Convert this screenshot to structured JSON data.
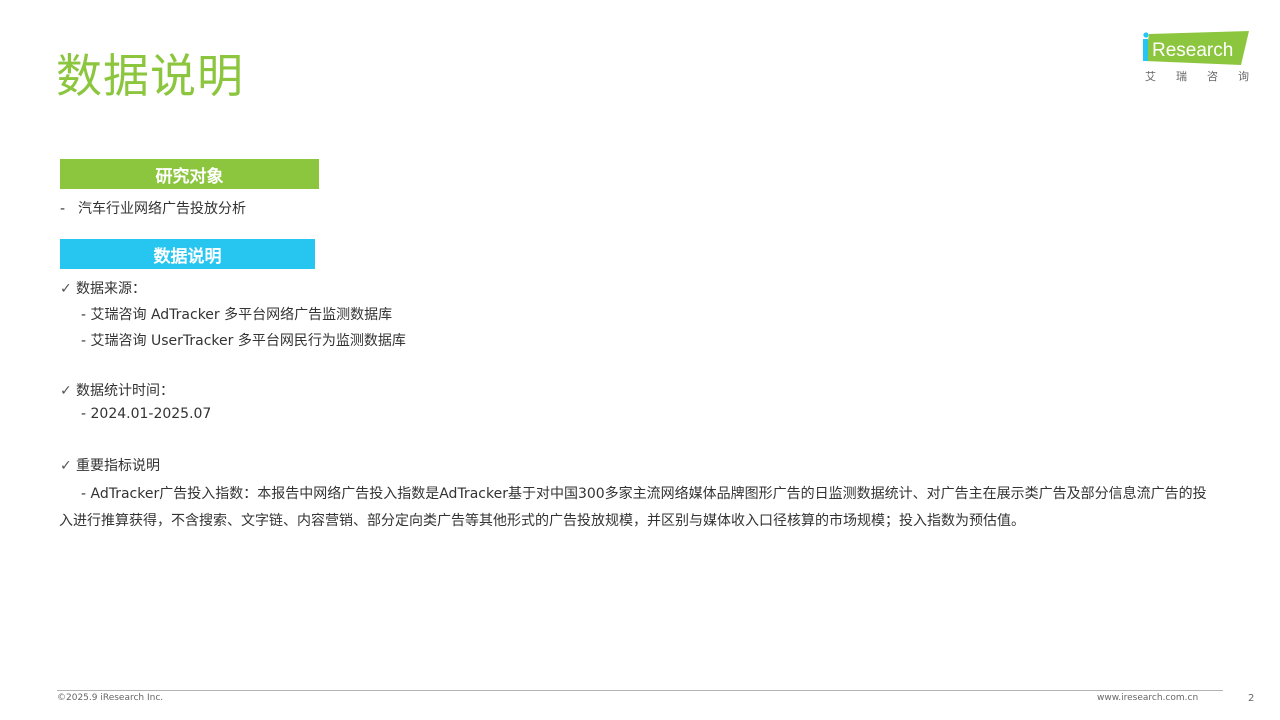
{
  "page": {
    "title": "数据说明"
  },
  "logo": {
    "brand": "iResearch",
    "brand_i": "i",
    "brand_rest": "Research",
    "sub_chars": [
      "艾",
      "瑞",
      "咨",
      "询"
    ],
    "colors": {
      "green": "#8cc63f",
      "blue": "#26c6f0"
    }
  },
  "research_object": {
    "heading": "研究对象",
    "bullet": "-",
    "item": "汽车行业网络广告投放分析"
  },
  "data_note": {
    "heading": "数据说明",
    "check_icon": "✓",
    "sources": {
      "label": "数据来源：",
      "items": [
        "- 艾瑞咨询 AdTracker 多平台网络广告监测数据库",
        "- 艾瑞咨询 UserTracker 多平台网民行为监测数据库"
      ]
    },
    "period": {
      "label": "数据统计时间：",
      "value": "- 2024.01-2025.07"
    },
    "indicator": {
      "label": "重要指标说明",
      "text": "- AdTracker广告投入指数：本报告中网络广告投入指数是AdTracker基于对中国300多家主流网络媒体品牌图形广告的日监测数据统计、对广告主在展示类广告及部分信息流广告的投入进行推算获得，不含搜索、文字链、内容营销、部分定向类广告等其他形式的广告投放规模，并区别与媒体收入口径核算的市场规模；投入指数为预估值。"
    }
  },
  "footer": {
    "copyright": "©2025.9 iResearch Inc.",
    "url": "www.iresearch.com.cn",
    "page_number": "2"
  },
  "colors": {
    "title_green": "#8cc63f",
    "bar_green": "#8cc63f",
    "bar_blue": "#26c6f0",
    "text": "#333333"
  }
}
